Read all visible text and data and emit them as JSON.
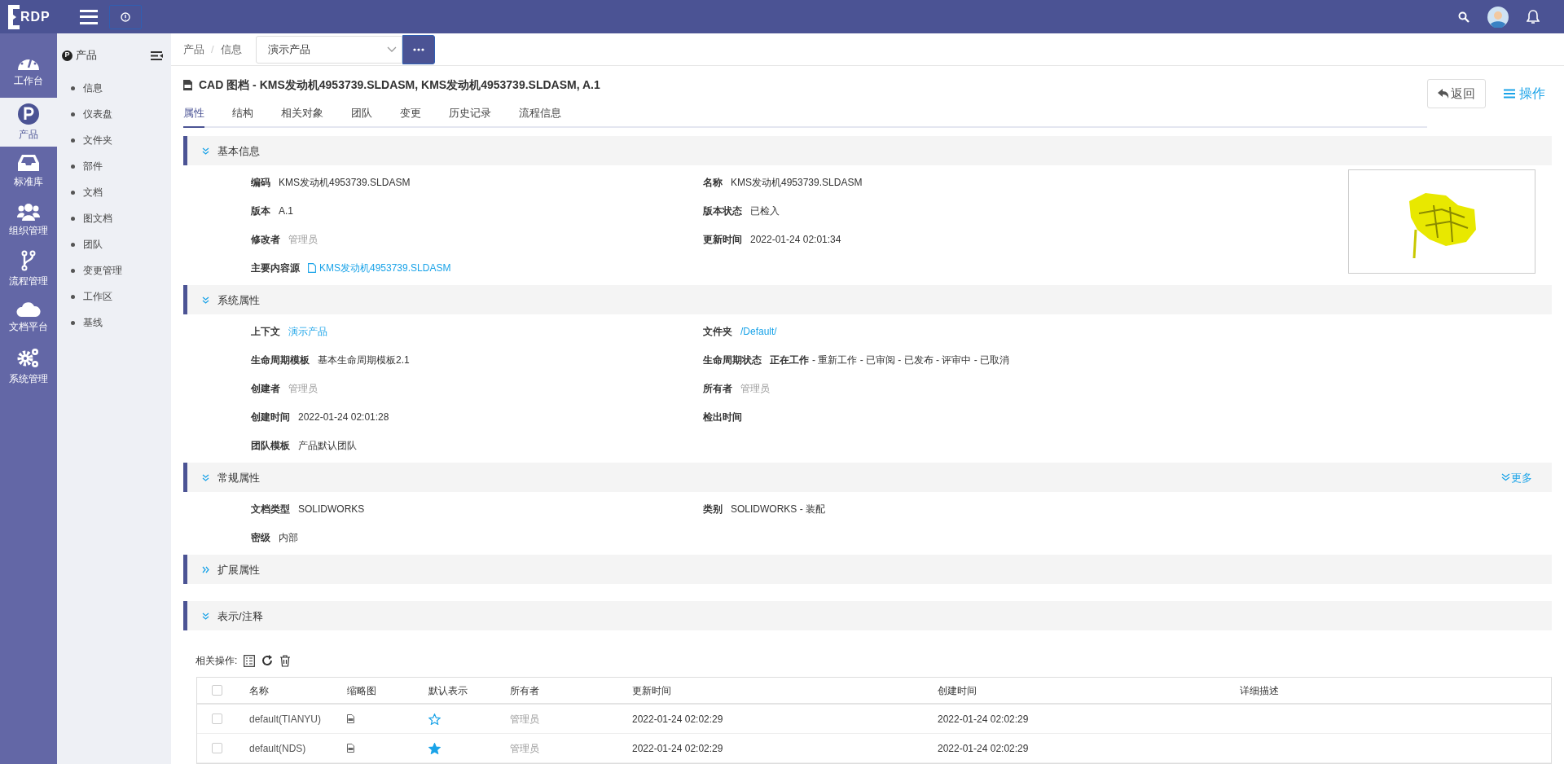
{
  "top_bar": {
    "logo": "RDP"
  },
  "rail": [
    {
      "label": "工作台",
      "kind": "gauge",
      "selected": false
    },
    {
      "label": "产品",
      "kind": "product",
      "selected": true
    },
    {
      "label": "标准库",
      "kind": "inbox",
      "selected": false
    },
    {
      "label": "组织管理",
      "kind": "users",
      "selected": false
    },
    {
      "label": "流程管理",
      "kind": "branch",
      "selected": false
    },
    {
      "label": "文档平台",
      "kind": "cloud",
      "selected": false
    },
    {
      "label": "系统管理",
      "kind": "gears",
      "selected": false
    }
  ],
  "nav": {
    "badge": "P",
    "title": "产品",
    "items": [
      "信息",
      "仪表盘",
      "文件夹",
      "部件",
      "文档",
      "图文档",
      "团队",
      "变更管理",
      "工作区",
      "基线"
    ]
  },
  "breadcrumb": {
    "items": [
      "产品",
      "信息"
    ],
    "separator": "/"
  },
  "product_select": {
    "value": "演示产品"
  },
  "document": {
    "title": "CAD 图档 - KMS发动机4953739.SLDASM, KMS发动机4953739.SLDASM, A.1",
    "back_button": "返回",
    "actions_button": "操作"
  },
  "tabs": [
    {
      "label": "属性",
      "selected": true
    },
    {
      "label": "结构",
      "selected": false
    },
    {
      "label": "相关对象",
      "selected": false
    },
    {
      "label": "团队",
      "selected": false
    },
    {
      "label": "变更",
      "selected": false
    },
    {
      "label": "历史记录",
      "selected": false
    },
    {
      "label": "流程信息",
      "selected": false
    }
  ],
  "sections": [
    {
      "title": "基本信息",
      "expanded": true,
      "thumbnail": true,
      "rows": [
        [
          {
            "label": "编码",
            "value": "KMS发动机4953739.SLDASM",
            "kind": "text"
          },
          {
            "label": "名称",
            "value": "KMS发动机4953739.SLDASM",
            "kind": "text"
          }
        ],
        [
          {
            "label": "版本",
            "value": "A.1",
            "kind": "text"
          },
          {
            "label": "版本状态",
            "value": "已检入",
            "kind": "text"
          }
        ],
        [
          {
            "label": "修改者",
            "value": "管理员",
            "kind": "muted"
          },
          {
            "label": "更新时间",
            "value": "2022-01-24 02:01:34",
            "kind": "text"
          }
        ],
        [
          {
            "label": "主要内容源",
            "value": "KMS发动机4953739.SLDASM",
            "kind": "file_link"
          }
        ]
      ]
    },
    {
      "title": "系统属性",
      "expanded": true,
      "rows": [
        [
          {
            "label": "上下文",
            "value": "演示产品",
            "kind": "link"
          },
          {
            "label": "文件夹",
            "value": "/Default/",
            "kind": "link"
          }
        ],
        [
          {
            "label": "生命周期模板",
            "value": "基本生命周期模板2.1",
            "kind": "text"
          },
          {
            "label": "生命周期状态",
            "value": "**正在工作** - 重新工作 - 已审阅 - 已发布 - 评审中 - 已取消",
            "kind": "text"
          }
        ],
        [
          {
            "label": "创建者",
            "value": "管理员",
            "kind": "muted"
          },
          {
            "label": "所有者",
            "value": "管理员",
            "kind": "muted"
          }
        ],
        [
          {
            "label": "创建时间",
            "value": "2022-01-24 02:01:28",
            "kind": "text"
          },
          {
            "label": "检出时间"
          }
        ],
        [
          {
            "label": "团队模板",
            "value": "产品默认团队",
            "kind": "text"
          }
        ]
      ]
    },
    {
      "title": "常规属性",
      "expanded": true,
      "more_link": "更多",
      "rows": [
        [
          {
            "label": "文档类型",
            "value": "SOLIDWORKS",
            "kind": "text"
          },
          {
            "label": "类别",
            "value": "SOLIDWORKS - 装配",
            "kind": "text"
          }
        ],
        [
          {
            "label": "密级",
            "value": "内部",
            "kind": "text"
          }
        ]
      ]
    },
    {
      "title": "扩展属性",
      "expanded": false
    },
    {
      "title": "表示/注释",
      "expanded": true
    }
  ],
  "table": {
    "toolbar_label": "相关操作:",
    "all_checked": false,
    "columns": [
      "名称",
      "缩略图",
      "默认表示",
      "所有者",
      "更新时间",
      "创建时间",
      "详细描述"
    ],
    "rows": [
      {
        "checked": false,
        "name": "default(TIANYU)",
        "default": false,
        "owner": "管理员",
        "updated": "2022-01-24 02:02:29",
        "created": "2022-01-24 02:02:29"
      },
      {
        "checked": false,
        "name": "default(NDS)",
        "default": true,
        "owner": "管理员",
        "updated": "2022-01-24 02:02:29",
        "created": "2022-01-24 02:02:29"
      }
    ]
  }
}
